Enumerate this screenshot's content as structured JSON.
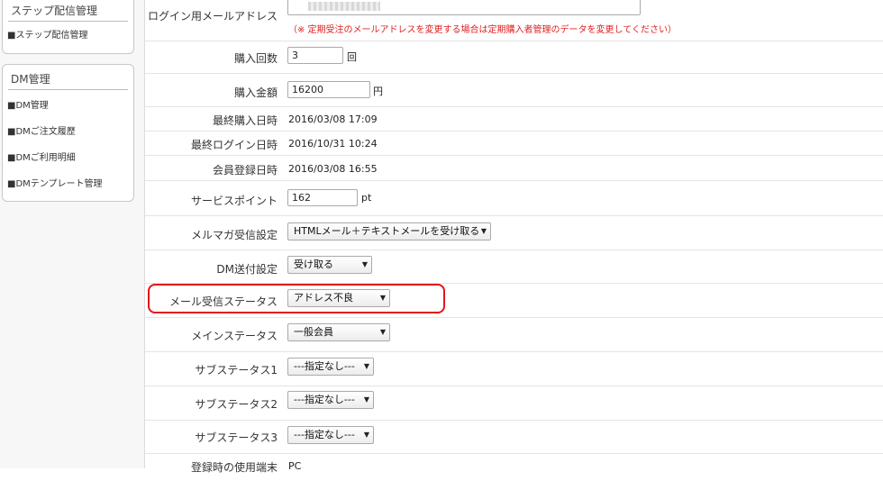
{
  "sidebar": {
    "step_panel": {
      "heading": "ステップ配信管理",
      "links": [
        "■ステップ配信管理"
      ]
    },
    "dm_panel": {
      "heading": "DM管理",
      "links": [
        "■DM管理",
        "■DMご注文履歴",
        "■DMご利用明細",
        "■DMテンプレート管理"
      ]
    }
  },
  "form": {
    "login_email": {
      "label": "ログイン用メールアドレス",
      "note": "（※ 定期受注のメールアドレスを変更する場合は定期購入者管理のデータを変更してください）"
    },
    "purchase_count": {
      "label": "購入回数",
      "value": "3",
      "unit": "回"
    },
    "purchase_amount": {
      "label": "購入金額",
      "value": "16200",
      "unit": "円"
    },
    "last_purchase": {
      "label": "最終購入日時",
      "value": "2016/03/08 17:09"
    },
    "last_login": {
      "label": "最終ログイン日時",
      "value": "2016/10/31 10:24"
    },
    "registered": {
      "label": "会員登録日時",
      "value": "2016/03/08 16:55"
    },
    "service_point": {
      "label": "サービスポイント",
      "value": "162",
      "unit": "pt"
    },
    "mailmag": {
      "label": "メルマガ受信設定",
      "selected": "HTMLメール＋テキストメールを受け取る"
    },
    "dm_send": {
      "label": "DM送付設定",
      "selected": "受け取る"
    },
    "mail_status": {
      "label": "メール受信ステータス",
      "selected": "アドレス不良"
    },
    "main_status": {
      "label": "メインステータス",
      "selected": "一般会員"
    },
    "sub_status1": {
      "label": "サブステータス1",
      "selected": "---指定なし---"
    },
    "sub_status2": {
      "label": "サブステータス2",
      "selected": "---指定なし---"
    },
    "sub_status3": {
      "label": "サブステータス3",
      "selected": "---指定なし---"
    },
    "device": {
      "label": "登録時の使用端末",
      "value": "PC"
    }
  },
  "highlight_color": "#e3141a"
}
